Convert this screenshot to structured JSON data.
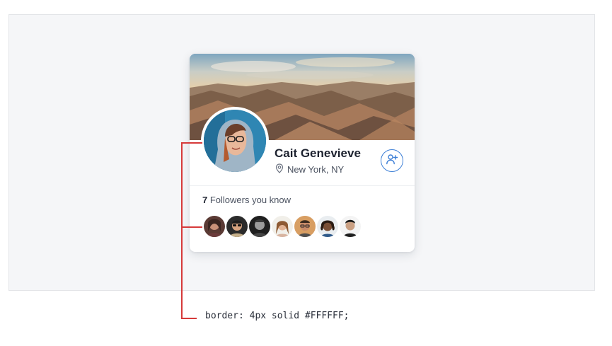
{
  "profile": {
    "name": "Cait Genevieve",
    "location": "New York, NY",
    "followers_count": "7",
    "followers_label": " Followers you know"
  },
  "annotation": {
    "css_text": "border: 4px solid #FFFFFF;",
    "line_color": "#d63a3a"
  },
  "accent_color": "#3d7fd6",
  "icons": {
    "location": "location-pin-icon",
    "follow": "add-user-icon"
  }
}
